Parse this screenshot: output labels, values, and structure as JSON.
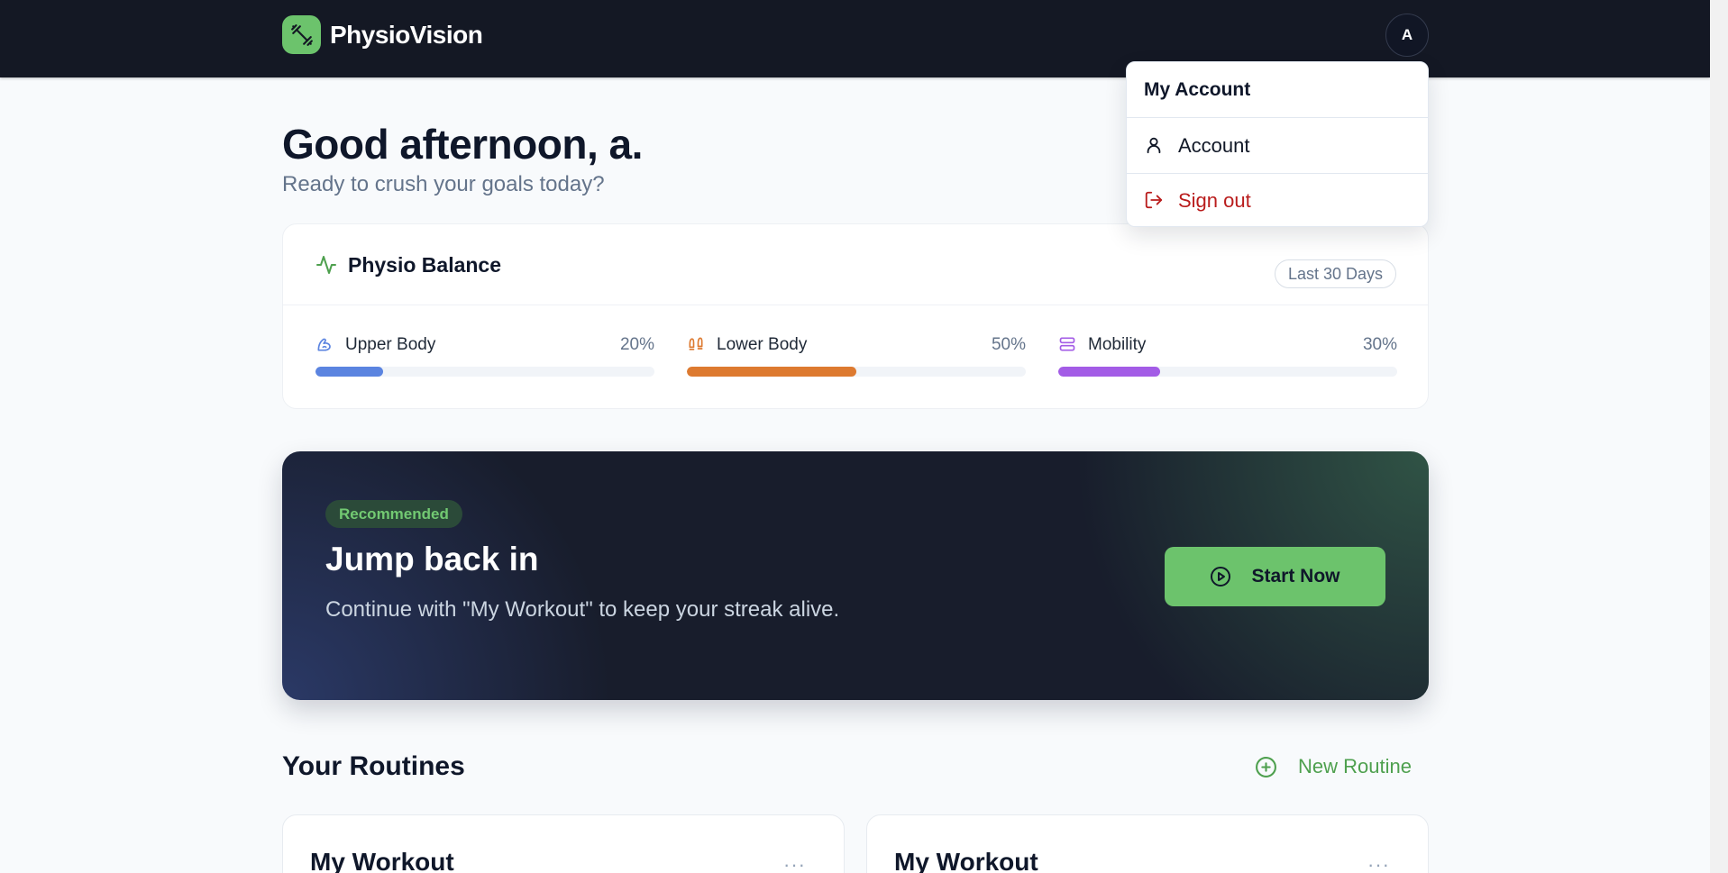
{
  "header": {
    "brand_name": "PhysioVision",
    "avatar_initial": "A"
  },
  "account_menu": {
    "title": "My Account",
    "account_label": "Account",
    "signout_label": "Sign out"
  },
  "greeting": {
    "title": "Good afternoon, a.",
    "subtitle": "Ready to crush your goals today?"
  },
  "balance": {
    "title": "Physio Balance",
    "range": "Last 30 Days",
    "metrics": [
      {
        "label": "Upper Body",
        "percent_label": "20%",
        "value": 0.2,
        "color": "#5b84e0",
        "icon": "flexed-arm-icon"
      },
      {
        "label": "Lower Body",
        "percent_label": "50%",
        "value": 0.5,
        "color": "#dd7a30",
        "icon": "footprints-icon"
      },
      {
        "label": "Mobility",
        "percent_label": "30%",
        "value": 0.3,
        "color": "#a35ce6",
        "icon": "stacked-layers-icon"
      }
    ]
  },
  "hero": {
    "badge": "Recommended",
    "title": "Jump back in",
    "description": "Continue with \"My Workout\" to keep your streak alive.",
    "button_label": "Start Now"
  },
  "routines": {
    "title": "Your Routines",
    "new_label": "New Routine",
    "cards": [
      {
        "title": "My Workout",
        "more": "···"
      },
      {
        "title": "My Workout",
        "more": "···"
      }
    ]
  },
  "colors": {
    "brand_green": "#6cc36c",
    "topbar": "#141824",
    "danger": "#b91c1c"
  }
}
